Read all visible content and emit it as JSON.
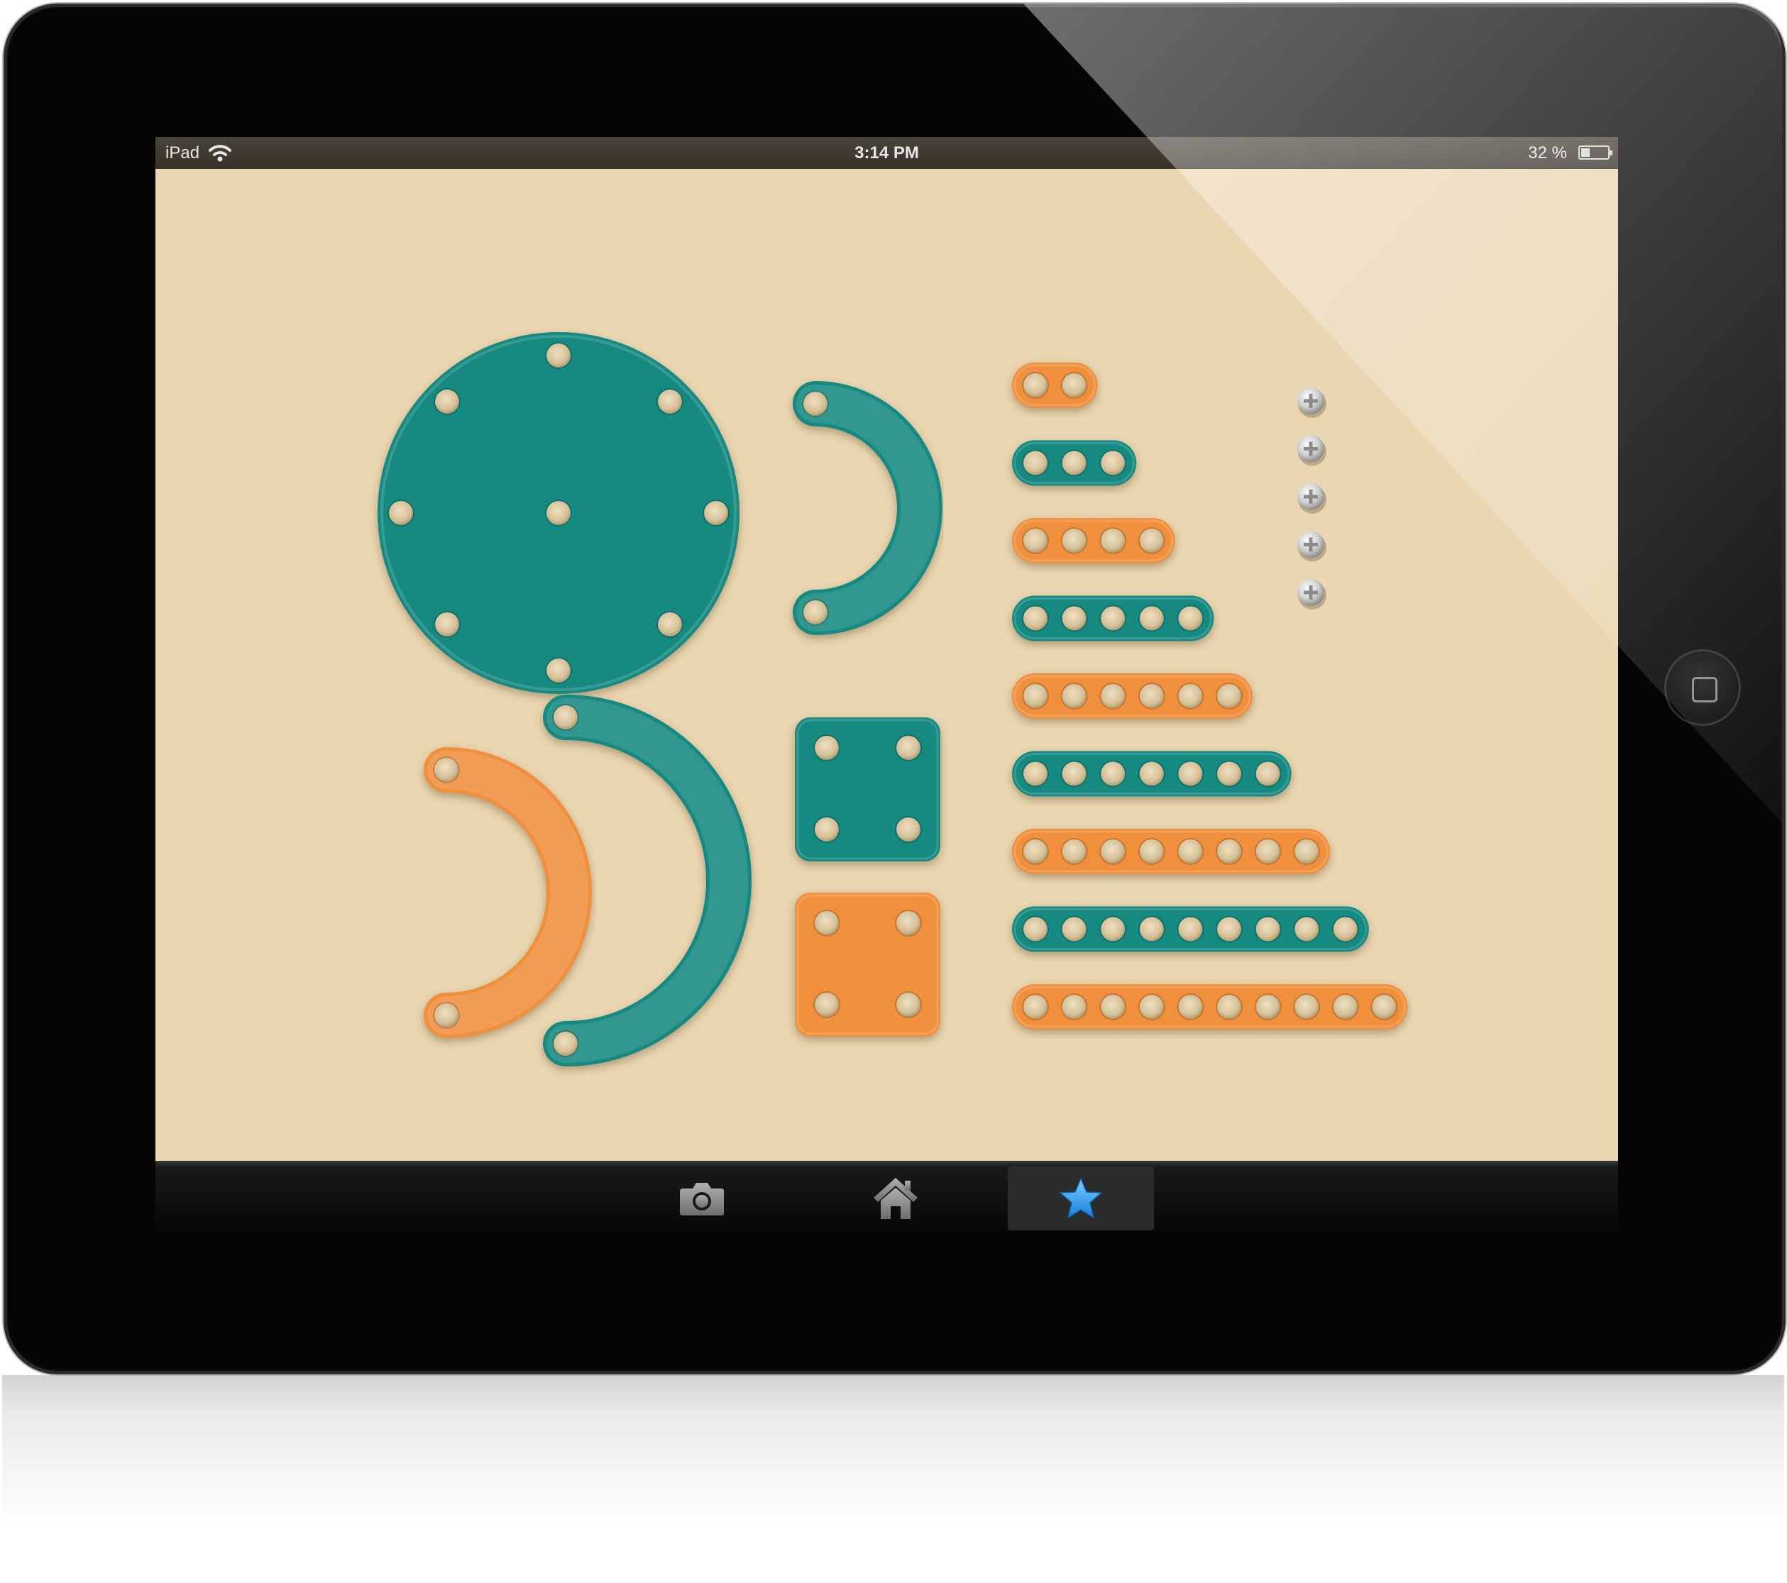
{
  "status_bar": {
    "carrier": "iPad",
    "time": "3:14 PM",
    "battery_text": "32 %",
    "battery_level": 0.32
  },
  "tab_bar": {
    "tabs": [
      {
        "icon": "camera-icon",
        "selected": false
      },
      {
        "icon": "home-icon",
        "selected": false
      },
      {
        "icon": "star-icon",
        "selected": true
      }
    ]
  },
  "palette": {
    "background": "#ead6b1",
    "teal": "#148a80",
    "orange": "#f0903e",
    "peg": "#d8c49e"
  },
  "parts": {
    "disc": {
      "count": 1,
      "holes": 9,
      "color": "teal"
    },
    "arcs": [
      {
        "size": "small",
        "color": "teal"
      },
      {
        "size": "medium",
        "color": "orange"
      },
      {
        "size": "large",
        "color": "teal"
      }
    ],
    "squares": [
      {
        "holes": 4,
        "color": "teal"
      },
      {
        "holes": 4,
        "color": "orange"
      }
    ],
    "bars": [
      {
        "holes": 2,
        "color": "orange"
      },
      {
        "holes": 3,
        "color": "teal"
      },
      {
        "holes": 4,
        "color": "orange"
      },
      {
        "holes": 5,
        "color": "teal"
      },
      {
        "holes": 6,
        "color": "orange"
      },
      {
        "holes": 7,
        "color": "teal"
      },
      {
        "holes": 8,
        "color": "orange"
      },
      {
        "holes": 9,
        "color": "teal"
      },
      {
        "holes": 10,
        "color": "orange"
      }
    ],
    "screws": {
      "count": 5
    }
  }
}
